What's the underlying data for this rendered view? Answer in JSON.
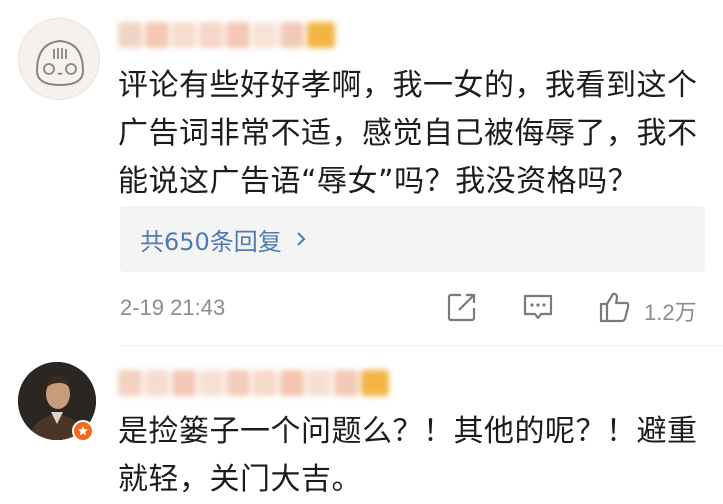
{
  "comments": [
    {
      "avatar_icon": "cartoon-face-avatar",
      "username_colors": [
        "#f2d4c4",
        "#f4c7b3",
        "#f6dccd",
        "#f5d6c7",
        "#f4c7b3",
        "#f7e2d6",
        "#f2cbb8",
        "#f2b544"
      ],
      "text": "评论有些好好孝啊，我一女的，我看到这个广告词非常不适，感觉自己被侮辱了，我不能说这广告语“辱女”吗？我没资格吗？",
      "replies_label": "共650条回复",
      "timestamp": "2-19 21:43",
      "like_count": "1.2万"
    },
    {
      "avatar_icon": "man-portrait-avatar",
      "badge_icon": "verified-badge-icon",
      "username_colors": [
        "#f3d1c0",
        "#f5dccf",
        "#f4c8b5",
        "#f6e0d4",
        "#f3cdb9",
        "#f5d9ca",
        "#f4c4ae",
        "#f6dfd2",
        "#f2c9b5",
        "#f2b544"
      ],
      "text": "是捡篓子一个问题么？！其他的呢？！避重就轻，关门大吉。"
    }
  ],
  "colors": {
    "link": "#4e7bb3",
    "meta": "#8c8c8c",
    "badge": "#f26b1d"
  }
}
